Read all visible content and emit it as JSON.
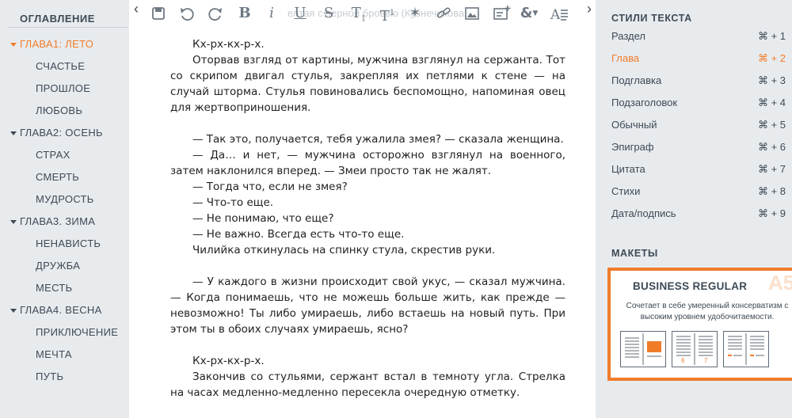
{
  "toc": {
    "title": "ОГЛАВЛЕНИЕ",
    "items": [
      {
        "label": "ГЛАВА1: ЛЕТО",
        "level": "chapter",
        "active": true
      },
      {
        "label": "СЧАСТЬЕ",
        "level": "sub"
      },
      {
        "label": "ПРОШЛОЕ",
        "level": "sub"
      },
      {
        "label": "ЛЮБОВЬ",
        "level": "sub"
      },
      {
        "label": "ГЛАВА2: ОСЕНЬ",
        "level": "chapter"
      },
      {
        "label": "СТРАХ",
        "level": "sub"
      },
      {
        "label": "СМЕРТЬ",
        "level": "sub"
      },
      {
        "label": "МУДРОСТЬ",
        "level": "sub"
      },
      {
        "label": "ГЛАВА3. ЗИМА",
        "level": "chapter"
      },
      {
        "label": "НЕНАВИСТЬ",
        "level": "sub"
      },
      {
        "label": "ДРУЖБА",
        "level": "sub"
      },
      {
        "label": "МЕСТЬ",
        "level": "sub"
      },
      {
        "label": "ГЛАВА4. ВЕСНА",
        "level": "chapter"
      },
      {
        "label": "ПРИКЛЮЧЕНИЕ",
        "level": "sub"
      },
      {
        "label": "МЕЧТА",
        "level": "sub"
      },
      {
        "label": "ПУТЬ",
        "level": "sub"
      }
    ]
  },
  "toolbar": {
    "ghost_text": "елтая с черной бровью (Кузнечикова..."
  },
  "editor": {
    "paragraphs": [
      "Кх-рх-кх-р-х.",
      "Оторвав взгляд от картины, мужчина взглянул на сержанта. Тот со скрипом двигал стулья, закрепляя их петлями к стене — на случай шторма. Стулья повиновались беспомощно, напоминая овец для жертвоприношения.",
      "",
      "— Так это, получается, тебя ужалила змея? — сказала женщина.",
      "— Да… и нет, — мужчина осторожно взглянул на военного, затем наклонился вперед. — Змеи просто так не жалят.",
      "— Тогда что, если не змея?",
      "— Что-то еще.",
      "— Не понимаю, что еще?",
      "— Не важно. Всегда есть что-то еще.",
      "Чилийка откинулась на спинку стула, скрестив руки.",
      "",
      "— У каждого в жизни происходит свой укус, — сказал мужчина. — Когда понимаешь, что не можешь больше жить, как прежде — невозможно! Ты либо умираешь, либо встаешь на новый путь. При этом ты в обоих случаях умираешь, ясно?",
      "",
      "Кх-рх-кх-р-х.",
      "Закончив со стульями, сержант встал в темноту угла. Стрелка на часах медленно-медленно пересекла очередную отметку."
    ]
  },
  "styles_panel": {
    "title": "СТИЛИ ТЕКСТА",
    "items": [
      {
        "label": "Раздел",
        "shortcut": "⌘ + 1"
      },
      {
        "label": "Глава",
        "shortcut": "⌘ + 2",
        "active": true
      },
      {
        "label": "Подглавка",
        "shortcut": "⌘ + 3"
      },
      {
        "label": "Подзаголовок",
        "shortcut": "⌘ + 4"
      },
      {
        "label": "Обычный",
        "shortcut": "⌘ + 5"
      },
      {
        "label": "Эпиграф",
        "shortcut": "⌘ + 6"
      },
      {
        "label": "Цитата",
        "shortcut": "⌘ + 7"
      },
      {
        "label": "Стихи",
        "shortcut": "⌘ + 8"
      },
      {
        "label": "Дата/подпись",
        "shortcut": "⌘ + 9"
      }
    ]
  },
  "layouts": {
    "title": "МАКЕТЫ",
    "card_title": "BUSINESS REGULAR",
    "format": "A5",
    "description": "Сочетает в себе умеренный консерватизм с высоким уровнем удобочитаемости.",
    "page_numbers": [
      "6",
      "7"
    ]
  },
  "colors": {
    "accent": "#f07c2a",
    "sidebar_bg": "#e8ebee",
    "text": "#3d4a55"
  },
  "icons": [
    "save-icon",
    "undo-icon",
    "redo-icon",
    "bold-icon",
    "italic-icon",
    "underline-icon",
    "strikethrough-icon",
    "subscript-icon",
    "superscript-icon",
    "asterisk-icon",
    "link-icon",
    "image-icon",
    "add-note-icon",
    "ampersand-icon",
    "text-format-icon",
    "chevron-left-icon",
    "chevron-right-icon"
  ]
}
